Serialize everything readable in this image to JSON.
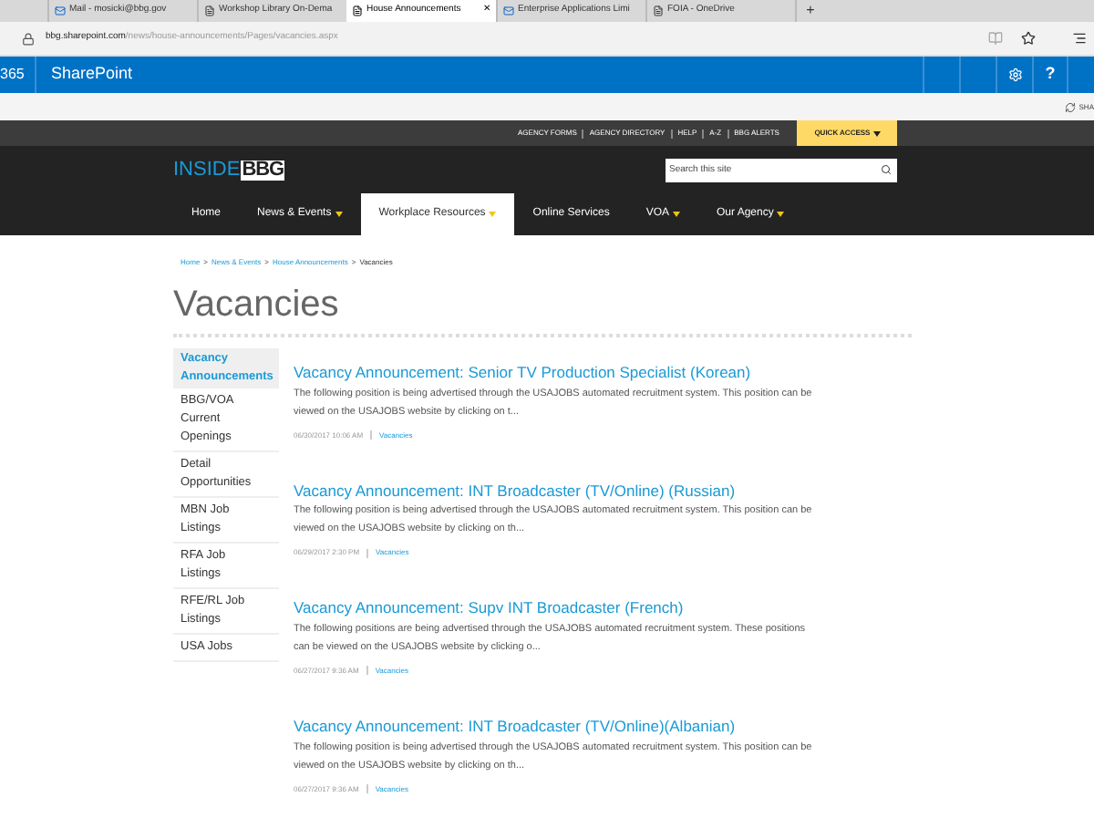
{
  "browser": {
    "tabs": [
      {
        "label": "Mail - mosicki@bbg.gov",
        "selected": false,
        "kind": "mail"
      },
      {
        "label": "Workshop Library On-Dema",
        "selected": false,
        "kind": "page"
      },
      {
        "label": "House Announcements",
        "selected": true,
        "kind": "page"
      },
      {
        "label": "Enterprise Applications Limi",
        "selected": false,
        "kind": "mail"
      },
      {
        "label": "FOIA - OneDrive",
        "selected": false,
        "kind": "page"
      }
    ],
    "new_tab": "+",
    "close": "✕",
    "address": {
      "host": "bbg.sharepoint.com",
      "path": "/news/house-announcements/Pages/vacancies.aspx"
    }
  },
  "suite_bar": {
    "app_suffix": "365",
    "title": "SharePoint",
    "help": "?",
    "share": "SHA"
  },
  "utility_links": [
    "AGENCY FORMS",
    "AGENCY DIRECTORY",
    "HELP",
    "A-Z",
    "BBG ALERTS"
  ],
  "quick_access": "QUICK ACCESS",
  "logo": {
    "first": "INSIDE",
    "second": "BBG"
  },
  "search": {
    "placeholder": "Search this site"
  },
  "nav": [
    {
      "label": "Home",
      "selected": false,
      "dropdown": false
    },
    {
      "label": "News & Events",
      "selected": false,
      "dropdown": true
    },
    {
      "label": "Workplace Resources",
      "selected": true,
      "dropdown": true
    },
    {
      "label": "Online Services",
      "selected": false,
      "dropdown": false
    },
    {
      "label": "VOA",
      "selected": false,
      "dropdown": true
    },
    {
      "label": "Our Agency",
      "selected": false,
      "dropdown": true
    }
  ],
  "breadcrumb": {
    "links": [
      "Home",
      "News & Events",
      "House Announcements"
    ],
    "current": "Vacancies",
    "separator": ">"
  },
  "page_title": "Vacancies",
  "sidebar": [
    {
      "label": "Vacancy Announcements",
      "selected": true
    },
    {
      "label": "BBG/VOA Current Openings",
      "selected": false
    },
    {
      "label": "Detail Opportunities",
      "selected": false
    },
    {
      "label": "MBN Job Listings",
      "selected": false
    },
    {
      "label": "RFA Job Listings",
      "selected": false
    },
    {
      "label": "RFE/RL Job Listings",
      "selected": false
    },
    {
      "label": "USA Jobs",
      "selected": false
    }
  ],
  "posts": [
    {
      "title": "Vacancy Announcement: Senior TV Production Specialist (Korean)",
      "summary": "The following position is being advertised through the USAJOBS automated recruitment system.  This position can be viewed on the USAJOBS website by clicking on t...",
      "date": "06/30/2017 10:06 AM",
      "category": "Vacancies"
    },
    {
      "title": "Vacancy Announcement: INT Broadcaster (TV/Online) (Russian)",
      "summary": "The following position is being advertised through the USAJOBS automated recruitment system.  This position can be viewed on the USAJOBS website by clicking on th...",
      "date": "06/29/2017 2:30 PM",
      "category": "Vacancies"
    },
    {
      "title": "Vacancy Announcement: Supv INT Broadcaster (French)",
      "summary": "The following positions are being advertised through the USAJOBS automated recruitment system.  These positions can be viewed on the USAJOBS website by clicking o...",
      "date": "06/27/2017 9:36 AM",
      "category": "Vacancies"
    },
    {
      "title": "Vacancy Announcement: INT Broadcaster (TV/Online)(Albanian)",
      "summary": "The following position is being advertised through the USAJOBS automated recruitment system.  This position can be viewed on the USAJOBS website by clicking on th...",
      "date": "06/27/2017 9:36 AM",
      "category": "Vacancies"
    }
  ]
}
